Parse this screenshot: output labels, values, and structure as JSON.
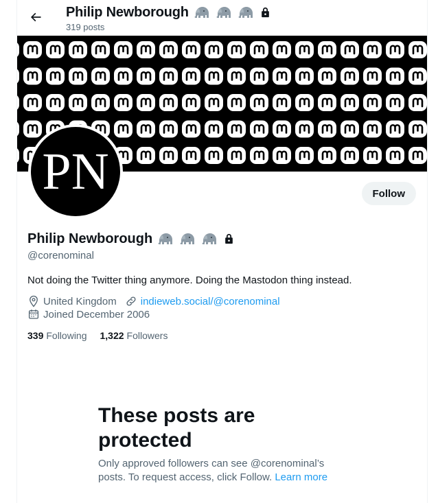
{
  "header": {
    "name": "Philip Newborough",
    "posts": "319 posts",
    "back_icon": "arrow-left-icon",
    "badge_icons": [
      "elephant-icon",
      "elephant-icon",
      "elephant-icon"
    ],
    "protected_icon": "lock-icon"
  },
  "banner": {
    "pattern_icon": "mastodon-logo-icon",
    "background": "#000000",
    "tile_color": "#ffffff"
  },
  "avatar": {
    "monogram": "PN"
  },
  "follow_button": {
    "label": "Follow"
  },
  "profile": {
    "name": "Philip Newborough",
    "handle": "@corenominal",
    "bio": "Not doing the Twitter thing anymore. Doing the Mastodon thing instead.",
    "location": "United Kingdom",
    "website": "indieweb.social/@corenominal",
    "joined": "Joined December 2006",
    "following_count": "339",
    "following_label": "Following",
    "followers_count": "1,322",
    "followers_label": "Followers"
  },
  "protected_notice": {
    "title": "These posts are protected",
    "text": "Only approved followers can see @corenominal’s posts. To request access, click Follow.",
    "link": "Learn more"
  },
  "colors": {
    "accent": "#1d9bf0",
    "text": "#0f1419",
    "secondary": "#536471",
    "button_bg": "#eff3f4"
  }
}
